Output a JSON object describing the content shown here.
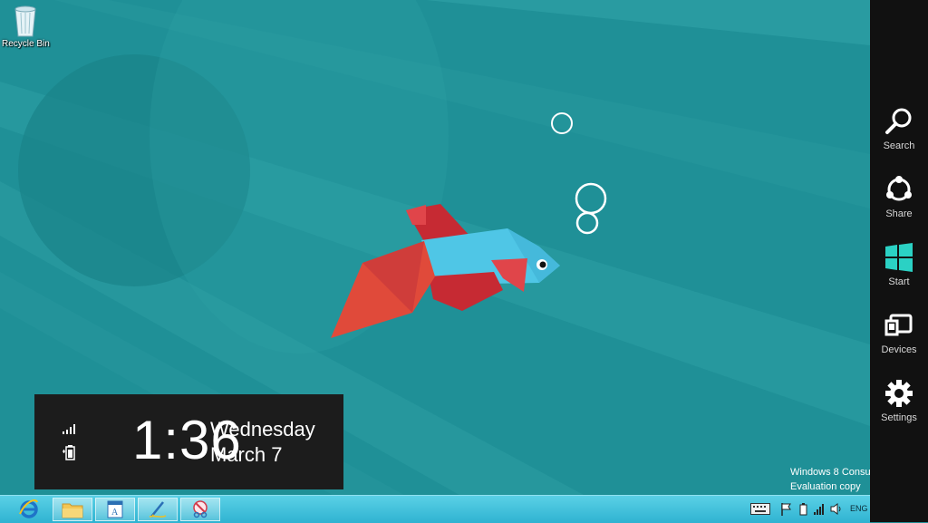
{
  "desktop": {
    "recycle_bin_label": "Recycle Bin"
  },
  "clock": {
    "time": "1:36",
    "day": "Wednesday",
    "date": "March 7"
  },
  "watermark": {
    "line1": "Windows 8 Consu",
    "line2": "Evaluation copy"
  },
  "charms": [
    {
      "label": "Search",
      "icon": "search-icon"
    },
    {
      "label": "Share",
      "icon": "share-icon"
    },
    {
      "label": "Start",
      "icon": "windows-logo-icon"
    },
    {
      "label": "Devices",
      "icon": "devices-icon"
    },
    {
      "label": "Settings",
      "icon": "gear-icon"
    }
  ],
  "taskbar": {
    "pinned": [
      {
        "name": "internet-explorer",
        "icon": "internet-explorer-icon"
      },
      {
        "name": "file-explorer",
        "icon": "folder-icon"
      },
      {
        "name": "wordpad",
        "icon": "document-icon"
      },
      {
        "name": "paint",
        "icon": "paint-icon"
      },
      {
        "name": "snipping-tool",
        "icon": "scissors-icon"
      }
    ],
    "tray": {
      "language": "ENG",
      "icons": [
        "keyboard-icon",
        "flag-icon",
        "battery-icon",
        "signal-icon",
        "volume-icon"
      ]
    }
  },
  "colors": {
    "wallpaper": "#1f8f96",
    "charms_bg": "#111111",
    "start_accent": "#2bd1c4",
    "fish_blue": "#4fc6e6",
    "fish_red": "#c62a33"
  }
}
